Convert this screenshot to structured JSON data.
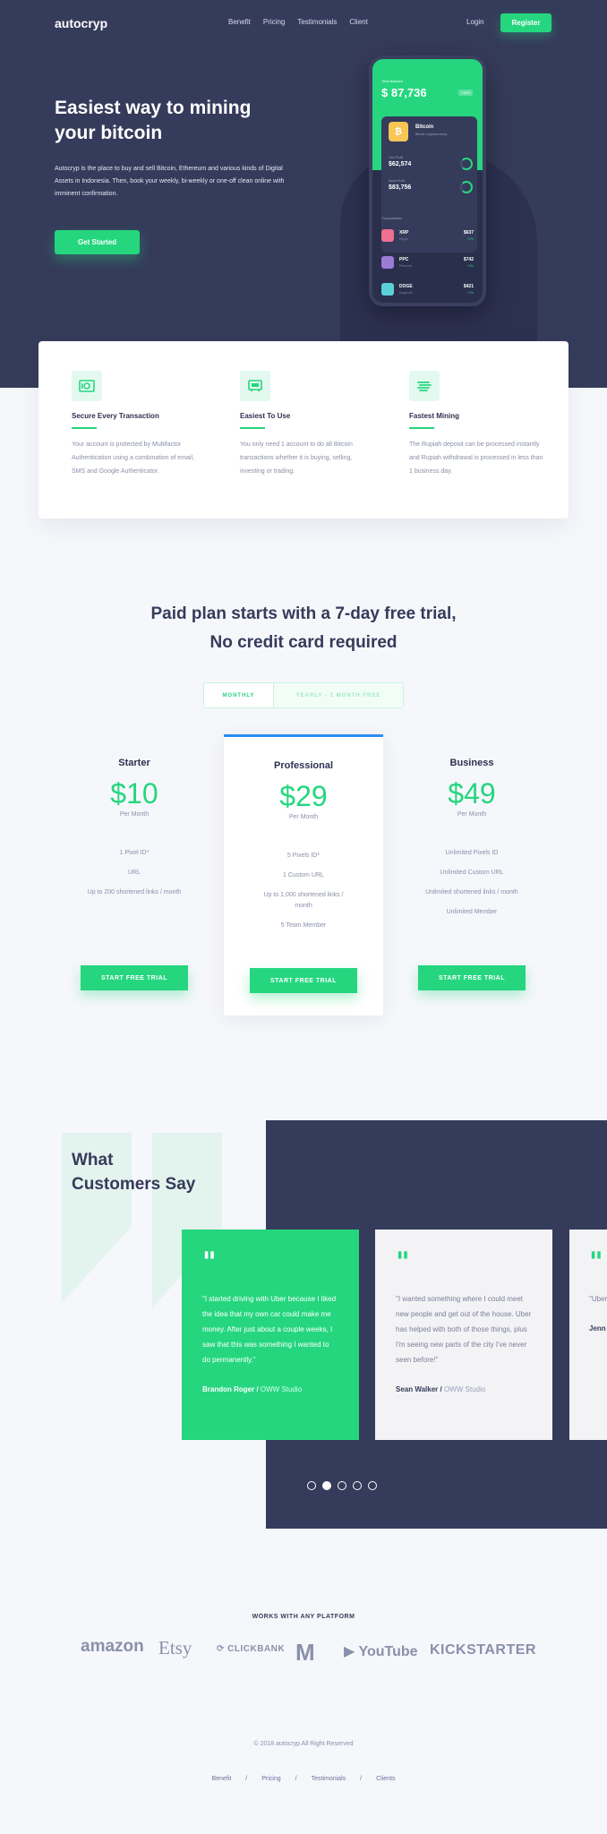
{
  "header": {
    "logo": "autocryp",
    "nav": [
      "Benefit",
      "Pricing",
      "Testimonials",
      "Client"
    ],
    "login": "Login",
    "register": "Register"
  },
  "hero": {
    "title": "Easiest way to mining your bitcoin",
    "description": "Autocryp is the place to buy and sell Bitcoin, Ethereum and various kinds of Digital Assets in Indonesia. Then, book your weekly, bi-weekly or one-off clean online with imminent confirmation.",
    "cta": "Get Started"
  },
  "phone": {
    "label": "Total Balance",
    "total": "$ 87,736",
    "badge": "+15%",
    "coin_name": "Bitcoin",
    "coin_sub": "Bitcoin Cryptocurrency",
    "stat1_label": "Your Profit",
    "stat1_value": "$62,574",
    "stat2_label": "Asset Profit",
    "stat2_value": "$83,756",
    "compare_label": "Comparation",
    "rows": [
      {
        "sym": "XRP",
        "sub": "Ripple",
        "val": "$637",
        "pct": "+2%",
        "color": "#ef6f8f"
      },
      {
        "sym": "PPC",
        "sub": "Peercoin",
        "val": "$742",
        "pct": "+3%",
        "color": "#9a7bd6"
      },
      {
        "sym": "DOGE",
        "sub": "Dogecoin",
        "val": "$421",
        "pct": "+1%",
        "color": "#5ad1d9"
      }
    ]
  },
  "features": [
    {
      "icon": "safe-icon",
      "title": "Secure Every Transaction",
      "desc": "Your account is protected by Multifactor Authentication using a combination of email, SMS and Google Authenticator."
    },
    {
      "icon": "device-icon",
      "title": "Easiest To Use",
      "desc": "You only need 1 account to do all Bitcoin transactions whether it is buying, selling, investing or trading."
    },
    {
      "icon": "speed-icon",
      "title": "Fastest Mining",
      "desc": "The Rupiah deposit can be processed instantly and Rupiah withdrawal is processed in less than 1 business day."
    }
  ],
  "pricing": {
    "title_line1": "Paid plan starts with a 7-day free trial,",
    "title_line2": "No credit card required",
    "toggle_monthly": "MONTHLY",
    "toggle_yearly": "YEARLY - 2 MONTH FREE",
    "plans": [
      {
        "name": "Starter",
        "price": "$10",
        "per": "Per Month",
        "features": [
          "1 Pixel ID*",
          "URL",
          "Up to 200 shortened links / month"
        ],
        "cta": "START FREE TRIAL"
      },
      {
        "name": "Professional",
        "price": "$29",
        "per": "Per Month",
        "features": [
          "5 Pixels ID*",
          "1 Custom URL",
          "Up to 1,000 shortened links / month",
          "5 Team Member"
        ],
        "cta": "START FREE TRIAL"
      },
      {
        "name": "Business",
        "price": "$49",
        "per": "Per Month",
        "features": [
          "Unlimited Pixels ID",
          "Unlimited Custom URL",
          "Unlimited shortened links / month",
          "Unlimited Member"
        ],
        "cta": "START FREE TRIAL"
      }
    ]
  },
  "testimonials": {
    "title_line1": "What",
    "title_line2": "Customers Say",
    "items": [
      {
        "text": "\"I started driving with Uber because I liked the idea that my own car could make me money. After just about a couple weeks, I saw that this was something I wanted to do permanently.\"",
        "author": "Brandon Roger /",
        "company": "OWW Studio"
      },
      {
        "text": "\"I wanted something where I could meet new people and get out of the house. Uber has helped with both of those things, plus I'm seeing new parts of the city I've never seen before!\"",
        "author": "Sean Walker /",
        "company": "OWW Studio"
      },
      {
        "text": "\"Uber creat cake I can have",
        "author": "Jenn",
        "company": ""
      }
    ]
  },
  "platforms": {
    "title": "WORKS WITH ANY PLATFORM",
    "logos": [
      "amazon",
      "Etsy",
      "CLICKBANK",
      "M",
      "YouTube",
      "KICKSTARTER"
    ]
  },
  "footer": {
    "copyright": "© 2018 autocryp All Right Reserved",
    "nav": [
      "Benefit",
      "Pricing",
      "Testimonials",
      "Clients"
    ],
    "separator": "/"
  },
  "colors": {
    "accent": "#25d67f",
    "dark": "#353b5a",
    "blue": "#2b8cf2"
  }
}
